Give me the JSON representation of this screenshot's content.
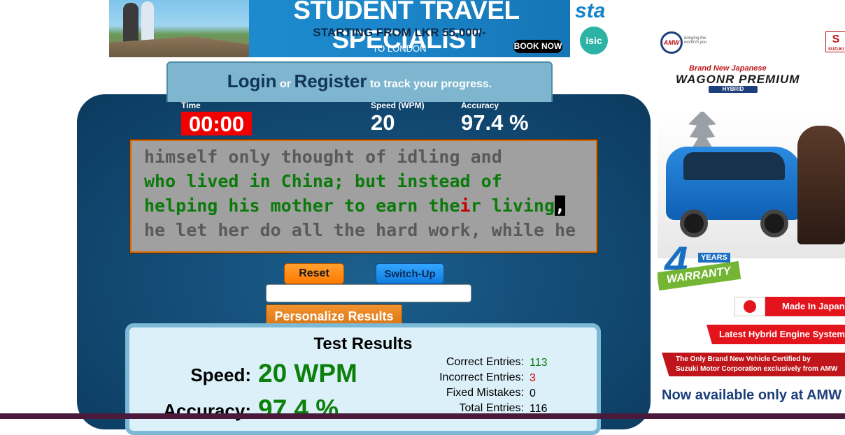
{
  "top_ad": {
    "headline": "STUDENT TRAVEL SPECIALIST",
    "subline": "STARTING FROM LKR 55,000/-",
    "destination": "TO LONDON",
    "cta": "BOOK NOW",
    "logo_sta": "sta",
    "logo_isic": "isic"
  },
  "auth": {
    "login": "Login",
    "or": "or",
    "register": "Register",
    "tagline": "to track your progress."
  },
  "stats": {
    "time_label": "Time",
    "time_value": "00:00",
    "speed_label": "Speed (WPM)",
    "speed_value": "20",
    "accuracy_label": "Accuracy",
    "accuracy_value": "97.4 %"
  },
  "typing_text": {
    "line1": "himself only thought of idling and",
    "line2": "who lived in China; but instead of",
    "line3_typed_a": "helping his mother to earn the",
    "line3_error": "i",
    "line3_typed_b": "r living",
    "line3_cursor": ",",
    "line4": "he let her do all the hard work, while he"
  },
  "controls": {
    "reset": "Reset",
    "switch_up": "Switch-Up",
    "input_value": "",
    "personalize": "Personalize Results"
  },
  "results": {
    "title": "Test Results",
    "speed_label": "Speed:",
    "speed_value": "20 WPM",
    "accuracy_label": "Accuracy:",
    "accuracy_value": "97.4 %",
    "entries": [
      {
        "label": "Correct Entries:",
        "value": "113",
        "color": "#0b800b"
      },
      {
        "label": "Incorrect Entries:",
        "value": "3",
        "color": "#d40000"
      },
      {
        "label": "Fixed Mistakes:",
        "value": "0",
        "color": "#000000"
      },
      {
        "label": "Total Entries:",
        "value": "116",
        "color": "#000000"
      }
    ]
  },
  "side_ad": {
    "amw_logo": "AMW",
    "amw_tagline": "bringing the world to you",
    "suzuki_logo": "SUZUKI",
    "brand_new": "Brand New Japanese",
    "model": "WAGONR PREMIUM",
    "hybrid": "HYBRID",
    "warranty_number": "4",
    "warranty_years": "YEARS",
    "warranty_word": "WARRANTY",
    "made_in": "Made In Japan",
    "engine": "Latest Hybrid Engine System",
    "certified_line1": "The Only Brand New Vehicle Certified by",
    "certified_line2": "Suzuki Motor Corporation exclusively from AMW",
    "available": "Now available only at AMW"
  },
  "colors": {
    "panel": "#134c76",
    "time_bg": "#f20000",
    "typed_correct": "#0b7a0b",
    "typed_error": "#c40000",
    "reset_btn": "#ff7a00",
    "switch_btn": "#1f8ef0"
  }
}
